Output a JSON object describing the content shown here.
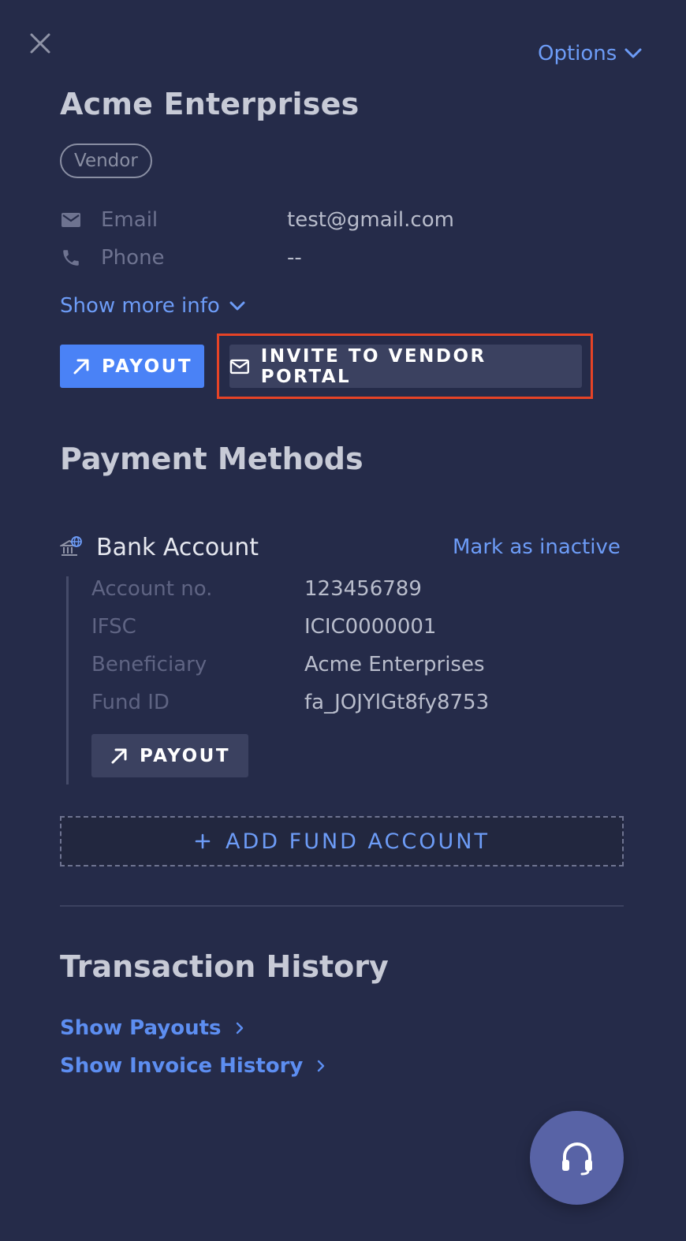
{
  "header": {
    "close_icon": "close-icon",
    "options_label": "Options"
  },
  "contact": {
    "name": "Acme Enterprises",
    "badge": "Vendor",
    "email_label": "Email",
    "email_value": "test@gmail.com",
    "phone_label": "Phone",
    "phone_value": "--",
    "show_more_label": "Show more info"
  },
  "actions": {
    "payout_label": "PAYOUT",
    "invite_label": "INVITE TO VENDOR PORTAL",
    "highlight_color": "#e64326"
  },
  "payment_methods": {
    "title": "Payment Methods",
    "account_type": "Bank Account",
    "mark_inactive_label": "Mark as inactive",
    "fields": [
      {
        "label": "Account no.",
        "value": "123456789"
      },
      {
        "label": "IFSC",
        "value": "ICIC0000001"
      },
      {
        "label": "Beneficiary",
        "value": "Acme Enterprises"
      },
      {
        "label": "Fund ID",
        "value": "fa_JOJYlGt8fy8753"
      }
    ],
    "payout_label": "PAYOUT",
    "add_fund_label": "ADD FUND ACCOUNT"
  },
  "transaction_history": {
    "title": "Transaction History",
    "show_payouts_label": "Show Payouts",
    "show_invoice_history_label": "Show Invoice History"
  },
  "colors": {
    "background": "#252b49",
    "accent": "#6d9cf7",
    "primary_button": "#4a82f6",
    "secondary_button": "#3b4160",
    "support_fab": "#5863a6"
  }
}
